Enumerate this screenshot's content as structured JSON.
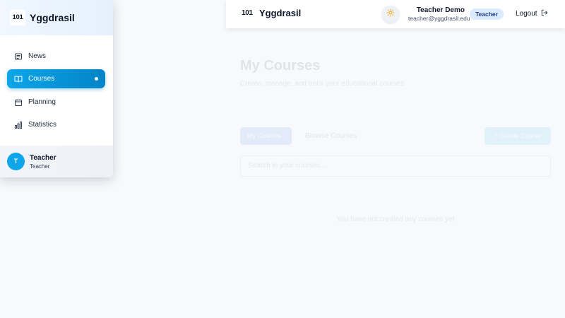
{
  "header": {
    "logo_text": "101",
    "brand": "Yggdrasil",
    "theme_icon": "sun-icon",
    "user_name": "Teacher Demo",
    "user_email": "teacher@yggdrasil.edu",
    "role_badge": "Teacher",
    "logout_label": "Logout",
    "logout_icon": "logout-icon"
  },
  "sidebar": {
    "logo_text": "101",
    "brand": "Yggdrasil",
    "items": [
      {
        "label": "News",
        "icon": "newspaper-icon",
        "active": false
      },
      {
        "label": "Courses",
        "icon": "book-icon",
        "active": true
      },
      {
        "label": "Planning",
        "icon": "calendar-icon",
        "active": false
      },
      {
        "label": "Statistics",
        "icon": "bar-chart-icon",
        "active": false
      }
    ],
    "footer": {
      "avatar_initial": "T",
      "name": "Teacher",
      "role": "Teacher"
    }
  },
  "main": {
    "title": "My Courses",
    "subtitle": "Create, manage, and track your educational courses",
    "tab_active": "My Courses",
    "tab_inactive": "Browse Courses",
    "create_button": "+ Create Course",
    "search_placeholder": "Search in your courses...",
    "empty_message": "You have not created any courses yet"
  },
  "colors": {
    "accent": "#0ea5e9",
    "accent_dark": "#0284c7",
    "badge_bg": "#dbeafe"
  }
}
